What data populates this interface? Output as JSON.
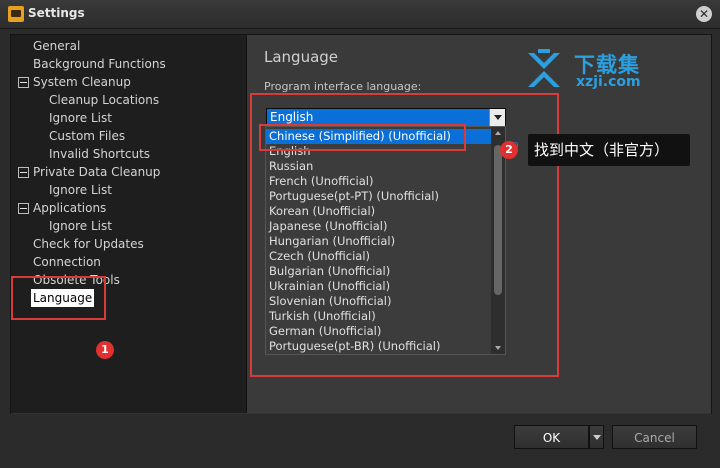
{
  "window": {
    "title": "Settings",
    "close_symbol": "✕"
  },
  "sidebar": {
    "items": [
      {
        "label": "General",
        "level": 1,
        "expander": false
      },
      {
        "label": "Background Functions",
        "level": 1,
        "expander": false
      },
      {
        "label": "System Cleanup",
        "level": 1,
        "expander": true
      },
      {
        "label": "Cleanup Locations",
        "level": 2,
        "expander": false
      },
      {
        "label": "Ignore List",
        "level": 2,
        "expander": false
      },
      {
        "label": "Custom Files",
        "level": 2,
        "expander": false
      },
      {
        "label": "Invalid Shortcuts",
        "level": 2,
        "expander": false
      },
      {
        "label": "Private Data Cleanup",
        "level": 1,
        "expander": true
      },
      {
        "label": "Ignore List",
        "level": 2,
        "expander": false
      },
      {
        "label": "Applications",
        "level": 1,
        "expander": true
      },
      {
        "label": "Ignore List",
        "level": 2,
        "expander": false
      },
      {
        "label": "Check for Updates",
        "level": 1,
        "expander": false
      },
      {
        "label": "Connection",
        "level": 1,
        "expander": false
      },
      {
        "label": "Obsolete Tools",
        "level": 1,
        "expander": false
      },
      {
        "label": "Language",
        "level": 1,
        "expander": false,
        "selected": true
      }
    ]
  },
  "language_panel": {
    "title": "Language",
    "field_label": "Program interface language:",
    "selected_value": "English",
    "options": [
      "Chinese (Simplified) (Unofficial)",
      "English",
      "Russian",
      "French (Unofficial)",
      "Portuguese(pt-PT) (Unofficial)",
      "Korean (Unofficial)",
      "Japanese (Unofficial)",
      "Hungarian (Unofficial)",
      "Czech (Unofficial)",
      "Bulgarian (Unofficial)",
      "Ukrainian (Unofficial)",
      "Slovenian (Unofficial)",
      "Turkish (Unofficial)",
      "German (Unofficial)",
      "Portuguese(pt-BR) (Unofficial)"
    ],
    "highlighted_index": 0,
    "link_fragment": "ap"
  },
  "annotations": {
    "badge1": "1",
    "badge2": "2",
    "callout": "找到中文（非官方）",
    "accent": "#d93a3a"
  },
  "watermark": {
    "line1": "下载集",
    "line2": "xzji.com"
  },
  "footer": {
    "ok_label": "OK",
    "cancel_label": "Cancel"
  }
}
